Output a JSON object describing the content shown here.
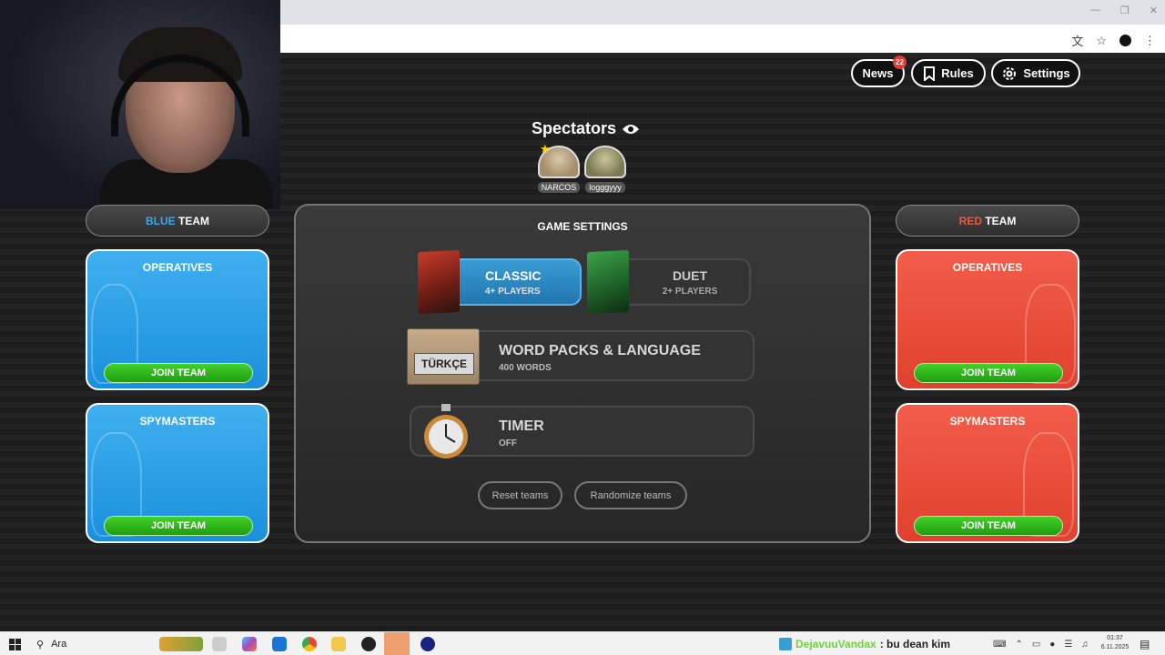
{
  "top_buttons": {
    "news_label": "News",
    "news_badge": "22",
    "rules_label": "Rules",
    "settings_label": "Settings"
  },
  "spectators": {
    "title": "Spectators",
    "users": [
      {
        "name": "NARCOS"
      },
      {
        "name": "logggyyy"
      }
    ]
  },
  "blue_team": {
    "header_color_word": "BLUE",
    "header_rest": " TEAM",
    "operatives_title": "OPERATIVES",
    "spymasters_title": "SPYMASTERS",
    "join_label": "JOIN TEAM",
    "color": "#2ea0e8"
  },
  "red_team": {
    "header_color_word": "RED",
    "header_rest": " TEAM",
    "operatives_title": "OPERATIVES",
    "spymasters_title": "SPYMASTERS",
    "join_label": "JOIN TEAM",
    "color": "#ec4b37"
  },
  "game_settings": {
    "title": "GAME SETTINGS",
    "modes": [
      {
        "name": "CLASSIC",
        "players": "4+ PLAYERS",
        "selected": true
      },
      {
        "name": "DUET",
        "players": "2+ PLAYERS",
        "selected": false
      }
    ],
    "word_packs": {
      "title": "WORD PACKS & LANGUAGE",
      "subtitle": "400 WORDS",
      "language_tag": "TÜRKÇE"
    },
    "timer": {
      "title": "TIMER",
      "subtitle": "OFF"
    },
    "reset_label": "Reset teams",
    "randomize_label": "Randomize teams"
  },
  "taskbar": {
    "search_label": "Ara",
    "chat_user": "DejavuuVandax",
    "chat_message": ": bu dean kim",
    "time": "01:37",
    "date": "6.11.2025"
  }
}
